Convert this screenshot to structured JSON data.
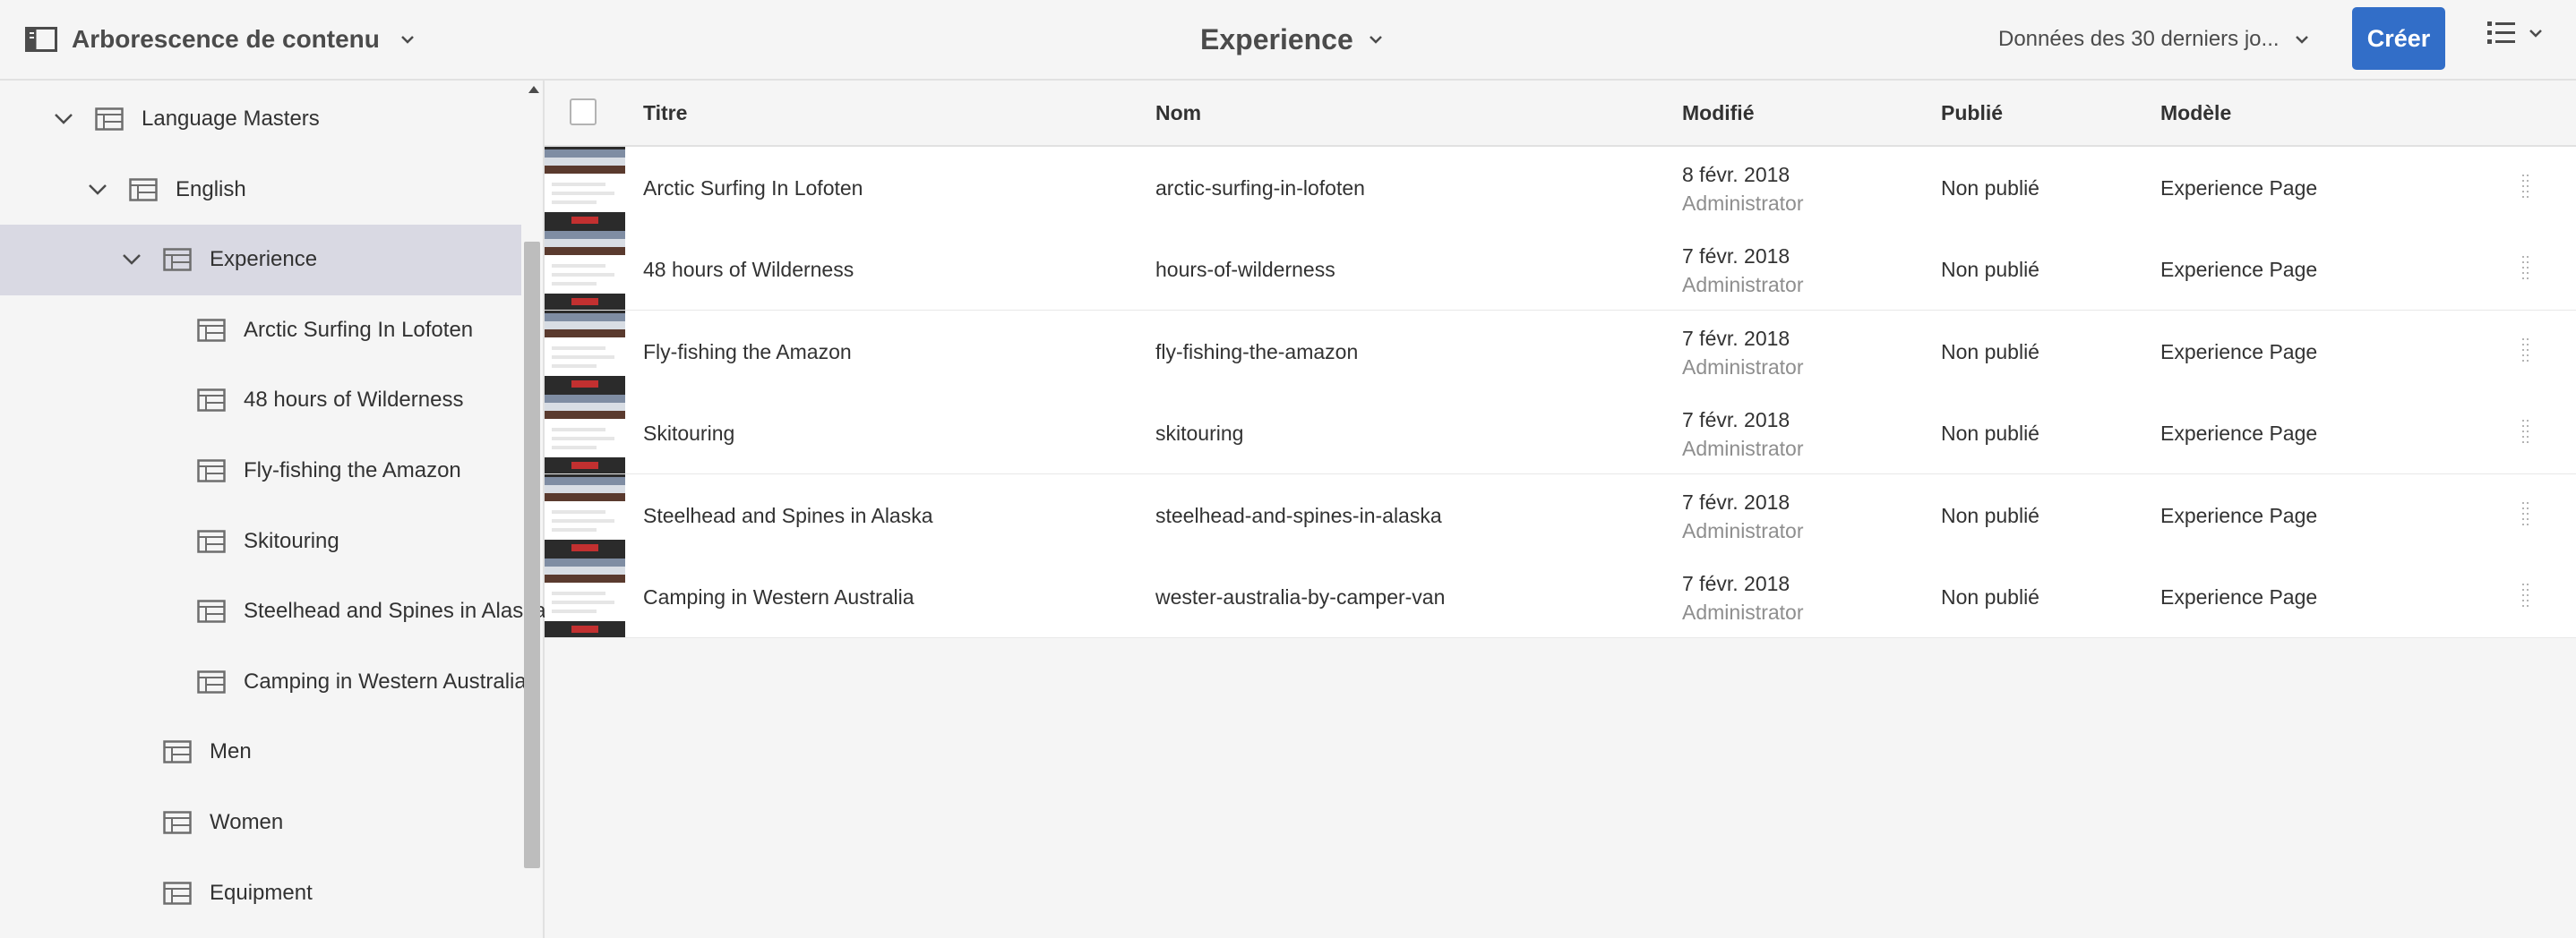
{
  "header": {
    "rail_title": "Arborescence de contenu",
    "breadcrumb": "Experience",
    "date_range": "Données des 30 derniers jo...",
    "create_label": "Créer"
  },
  "sidebar": {
    "items": [
      {
        "label": "Language Masters",
        "level": 0,
        "expanded": true,
        "selected": false
      },
      {
        "label": "English",
        "level": 1,
        "expanded": true,
        "selected": false
      },
      {
        "label": "Experience",
        "level": 2,
        "expanded": true,
        "selected": true
      },
      {
        "label": "Arctic Surfing In Lofoten",
        "level": 3,
        "expanded": false,
        "selected": false
      },
      {
        "label": "48 hours of Wilderness",
        "level": 3,
        "expanded": false,
        "selected": false
      },
      {
        "label": "Fly-fishing the Amazon",
        "level": 3,
        "expanded": false,
        "selected": false
      },
      {
        "label": "Skitouring",
        "level": 3,
        "expanded": false,
        "selected": false
      },
      {
        "label": "Steelhead and Spines in Alaska",
        "level": 3,
        "expanded": false,
        "selected": false
      },
      {
        "label": "Camping in Western Australia",
        "level": 3,
        "expanded": false,
        "selected": false
      },
      {
        "label": "Men",
        "level": 2,
        "expanded": false,
        "selected": false
      },
      {
        "label": "Women",
        "level": 2,
        "expanded": false,
        "selected": false
      },
      {
        "label": "Equipment",
        "level": 2,
        "expanded": false,
        "selected": false
      }
    ]
  },
  "table": {
    "columns": [
      "Titre",
      "Nom",
      "Modifié",
      "Publié",
      "Modèle"
    ],
    "rows": [
      {
        "title": "Arctic Surfing In Lofoten",
        "name": "arctic-surfing-in-lofoten",
        "modified": "8 févr. 2018",
        "modified_by": "Administrator",
        "published": "Non publié",
        "template": "Experience Page"
      },
      {
        "title": "48 hours of Wilderness",
        "name": "hours-of-wilderness",
        "modified": "7 févr. 2018",
        "modified_by": "Administrator",
        "published": "Non publié",
        "template": "Experience Page"
      },
      {
        "title": "Fly-fishing the Amazon",
        "name": "fly-fishing-the-amazon",
        "modified": "7 févr. 2018",
        "modified_by": "Administrator",
        "published": "Non publié",
        "template": "Experience Page"
      },
      {
        "title": "Skitouring",
        "name": "skitouring",
        "modified": "7 févr. 2018",
        "modified_by": "Administrator",
        "published": "Non publié",
        "template": "Experience Page"
      },
      {
        "title": "Steelhead and Spines in Alaska",
        "name": "steelhead-and-spines-in-alaska",
        "modified": "7 févr. 2018",
        "modified_by": "Administrator",
        "published": "Non publié",
        "template": "Experience Page"
      },
      {
        "title": "Camping in Western Australia",
        "name": "wester-australia-by-camper-van",
        "modified": "7 févr. 2018",
        "modified_by": "Administrator",
        "published": "Non publié",
        "template": "Experience Page"
      }
    ]
  },
  "colors": {
    "accent": "#326ec8",
    "selected_row": "#d9d9e3",
    "background": "#f5f5f5"
  },
  "icons": [
    "rail-toggle-icon",
    "chevron-down-icon",
    "list-view-icon",
    "page-icon",
    "drag-handle-icon"
  ]
}
